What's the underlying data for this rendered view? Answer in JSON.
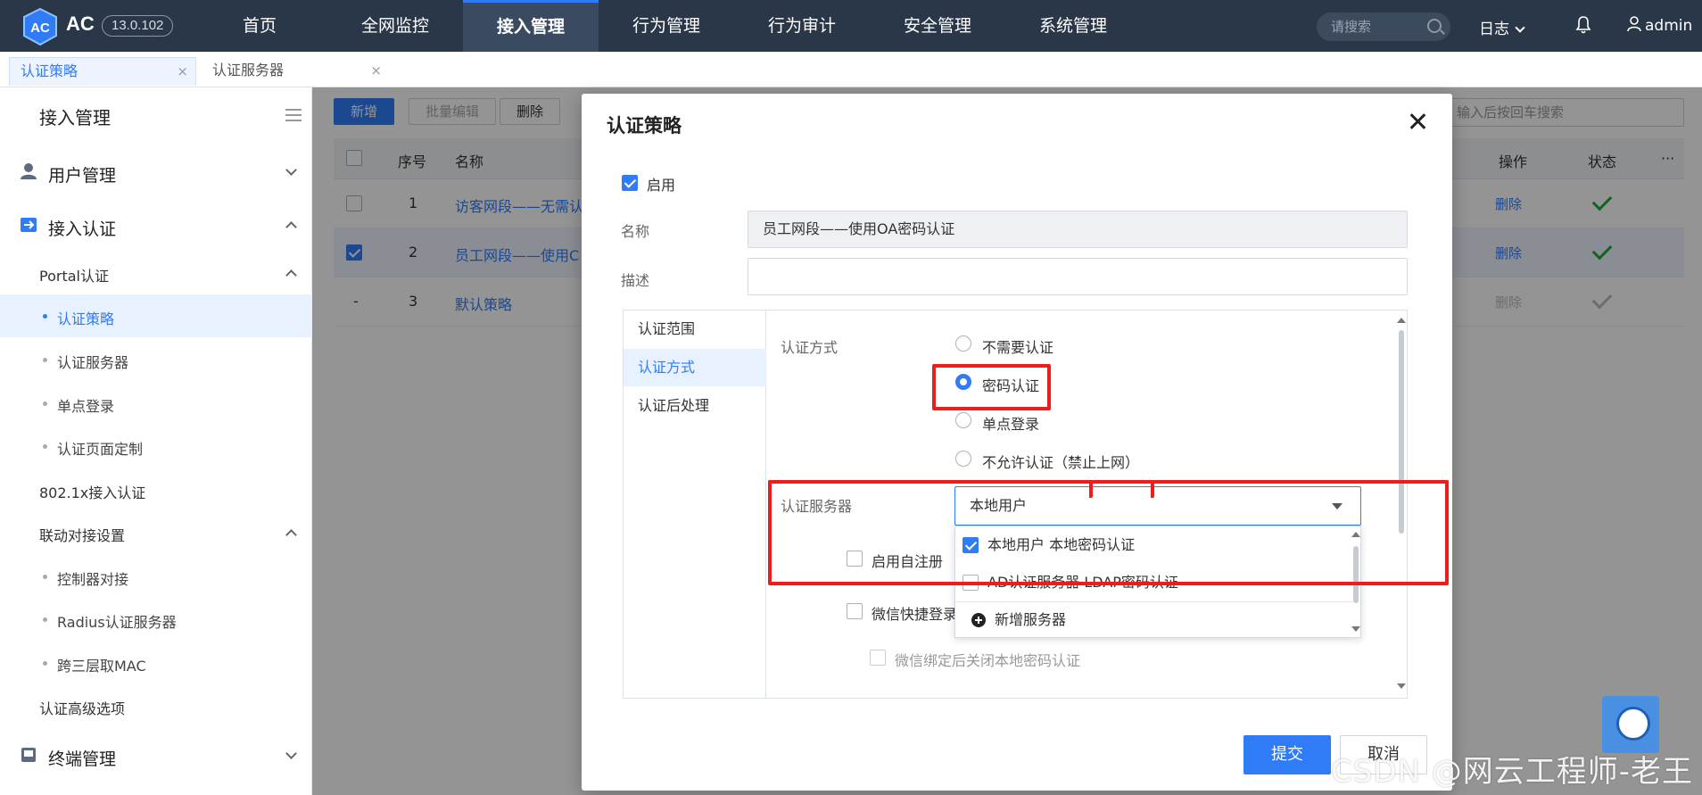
{
  "app": {
    "brand": "AC",
    "version": "13.0.102"
  },
  "nav": {
    "items": [
      "首页",
      "全网监控",
      "接入管理",
      "行为管理",
      "行为审计",
      "安全管理",
      "系统管理"
    ],
    "search_placeholder": "请搜索",
    "log_label": "日志",
    "user": "admin"
  },
  "tabs": [
    {
      "label": "认证策略"
    },
    {
      "label": "认证服务器"
    }
  ],
  "sidebar": {
    "title": "接入管理",
    "items": [
      {
        "label": "用户管理"
      },
      {
        "label": "接入认证"
      },
      {
        "label": "Portal认证"
      },
      {
        "label": "认证策略"
      },
      {
        "label": "认证服务器"
      },
      {
        "label": "单点登录"
      },
      {
        "label": "认证页面定制"
      },
      {
        "label": "802.1x接入认证"
      },
      {
        "label": "联动对接设置"
      },
      {
        "label": "控制器对接"
      },
      {
        "label": "Radius认证服务器"
      },
      {
        "label": "跨三层取MAC"
      },
      {
        "label": "认证高级选项"
      },
      {
        "label": "终端管理"
      }
    ]
  },
  "toolbar": {
    "add": "新增",
    "batch_edit": "批量编辑",
    "delete": "删除",
    "search_placeholder": "输入后按回车搜索"
  },
  "table": {
    "headers": {
      "index": "序号",
      "name": "名称",
      "action": "操作",
      "status": "状态",
      "more": "···"
    },
    "rows": [
      {
        "index": "1",
        "name": "访客网段——无需认",
        "action": "删除",
        "checked": false,
        "enabled": true
      },
      {
        "index": "2",
        "name": "员工网段——使用C",
        "action": "删除",
        "checked": true,
        "enabled": true
      },
      {
        "index": "3",
        "name": "默认策略",
        "action": "删除",
        "checked": null,
        "enabled": false,
        "dash": "-"
      }
    ]
  },
  "modal": {
    "title": "认证策略",
    "enable_label": "启用",
    "enabled": true,
    "name_label": "名称",
    "name_value": "员工网段——使用OA密码认证",
    "desc_label": "描述",
    "desc_value": "",
    "tabs": [
      "认证范围",
      "认证方式",
      "认证后处理"
    ],
    "auth_method_label": "认证方式",
    "auth_methods": [
      "不需要认证",
      "密码认证",
      "单点登录",
      "不允许认证（禁止上网）"
    ],
    "auth_selected": "密码认证",
    "auth_server_label": "认证服务器",
    "auth_server_value": "本地用户",
    "server_options": [
      {
        "label": "本地用户 本地密码认证",
        "checked": true
      },
      {
        "label": "AD认证服务器 LDAP密码认证",
        "checked": false
      }
    ],
    "add_server": "新增服务器",
    "self_register": "启用自注册",
    "wechat_login": "微信快捷登录",
    "wechat_close_pwd": "微信绑定后关闭本地密码认证",
    "submit": "提交",
    "cancel": "取消"
  },
  "watermark": "CSDN @网云工程师-老王",
  "colors": {
    "accent": "#2f7cf6",
    "nav_bg": "#2a3748",
    "highlight": "#f01c1c",
    "success": "#1aad3a"
  }
}
